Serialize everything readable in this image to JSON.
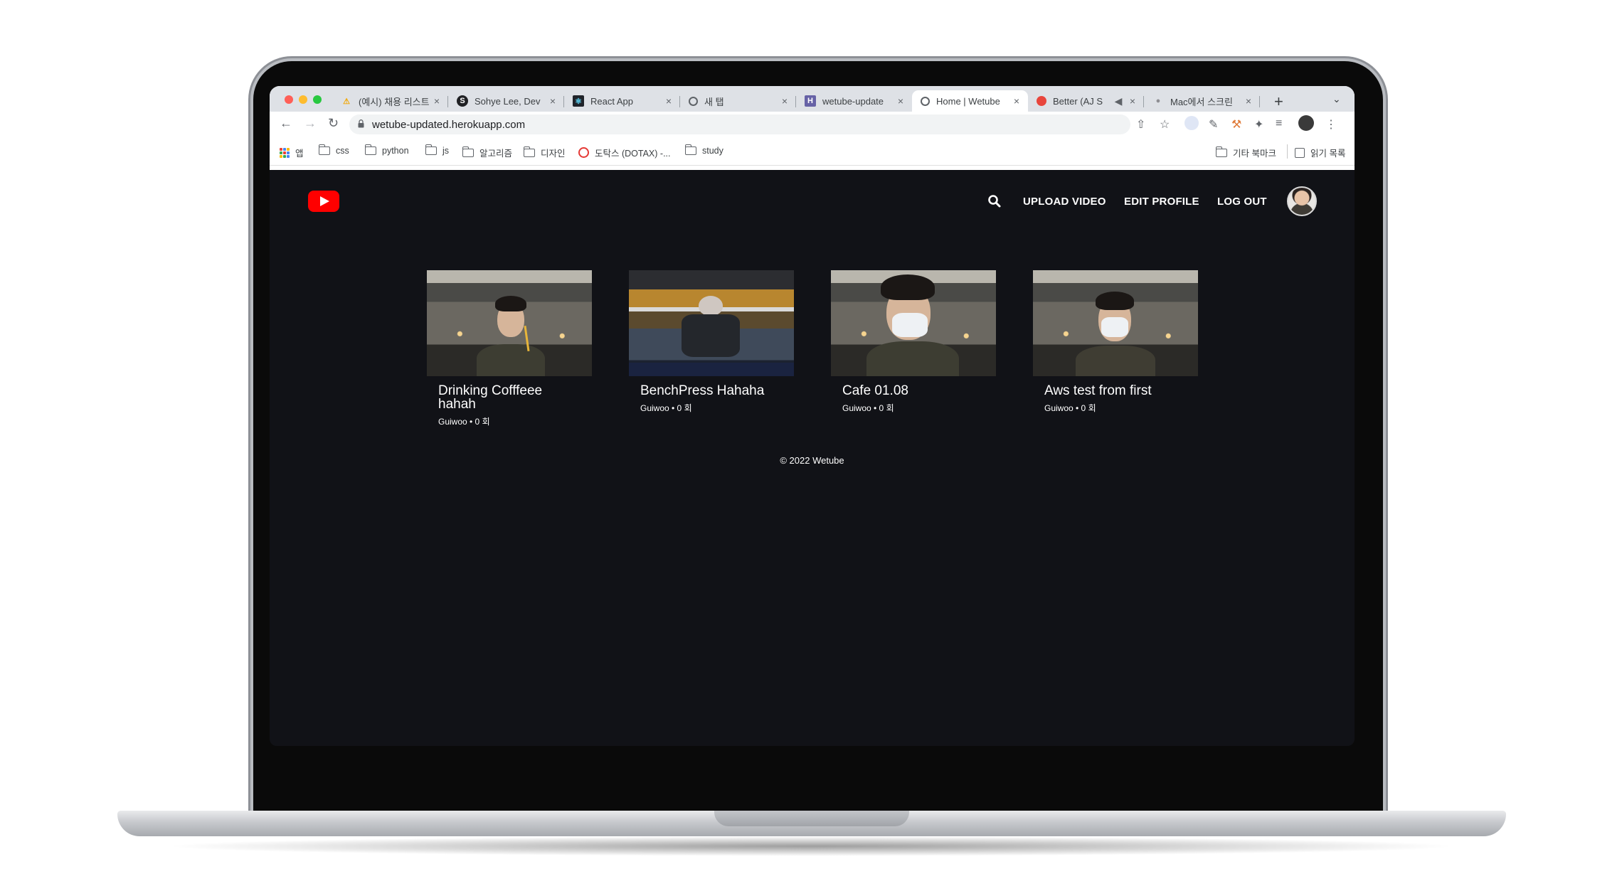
{
  "browser": {
    "tabs": [
      {
        "title": "(예시) 채용 리스트",
        "favicon": "warning-icon",
        "active": false
      },
      {
        "title": "Sohye Lee, Dev",
        "favicon": "s-logo-icon",
        "active": false
      },
      {
        "title": "React App",
        "favicon": "react-icon",
        "active": false
      },
      {
        "title": "새 탭",
        "favicon": "chrome-icon",
        "active": false
      },
      {
        "title": "wetube-update",
        "favicon": "heroku-icon",
        "active": false
      },
      {
        "title": "Home | Wetube",
        "favicon": "globe-icon",
        "active": true
      },
      {
        "title": "Better (AJ S",
        "favicon": "record-icon",
        "active": false
      },
      {
        "title": "Mac에서 스크린",
        "favicon": "apple-icon",
        "active": false
      }
    ],
    "new_tab": "+",
    "tab_close": "×",
    "url": "wetube-updated.herokuapp.com",
    "bookmarks": [
      {
        "label": "앱",
        "type": "apps"
      },
      {
        "label": "css",
        "type": "folder"
      },
      {
        "label": "python",
        "type": "folder"
      },
      {
        "label": "js",
        "type": "folder"
      },
      {
        "label": "알고리즘",
        "type": "folder"
      },
      {
        "label": "디자인",
        "type": "folder"
      },
      {
        "label": "도탁스 (DOTAX) -...",
        "type": "site"
      },
      {
        "label": "study",
        "type": "folder"
      }
    ],
    "bookmarks_right": [
      {
        "label": "기타 북마크",
        "type": "folder"
      },
      {
        "label": "읽기 목록",
        "type": "reading-list"
      }
    ]
  },
  "header": {
    "nav": [
      "UPLOAD VIDEO",
      "EDIT PROFILE",
      "LOG OUT"
    ]
  },
  "videos": [
    {
      "title": "Drinking Cofffeee hahah",
      "meta": "Guiwoo • 0 회"
    },
    {
      "title": "BenchPress Hahaha",
      "meta": "Guiwoo • 0 회"
    },
    {
      "title": "Cafe 01.08",
      "meta": "Guiwoo • 0 회"
    },
    {
      "title": "Aws test from first",
      "meta": "Guiwoo • 0 회"
    }
  ],
  "footer": "© 2022 Wetube",
  "colors": {
    "page_bg": "#111217",
    "brand_red": "#ff0000",
    "tabstrip_bg": "#dee1e6"
  }
}
